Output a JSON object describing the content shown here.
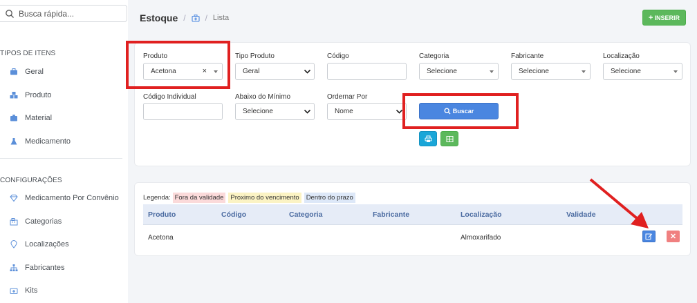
{
  "sidebar": {
    "search_placeholder": "Busca rápida...",
    "section_types": "TIPOS DE ITENS",
    "types": [
      {
        "label": "Geral",
        "icon": "briefcase-icon"
      },
      {
        "label": "Produto",
        "icon": "cubes-icon"
      },
      {
        "label": "Material",
        "icon": "suitcase-icon"
      },
      {
        "label": "Medicamento",
        "icon": "flask-icon"
      }
    ],
    "section_config": "CONFIGURAÇÕES",
    "config": [
      {
        "label": "Medicamento Por Convênio",
        "icon": "diamond-icon"
      },
      {
        "label": "Categorias",
        "icon": "building-icon"
      },
      {
        "label": "Localizações",
        "icon": "map-marker-icon"
      },
      {
        "label": "Fabricantes",
        "icon": "sitemap-icon"
      },
      {
        "label": "Kits",
        "icon": "medkit-icon"
      }
    ]
  },
  "header": {
    "title": "Estoque",
    "breadcrumb_current": "Lista",
    "insert_label": "INSERIR"
  },
  "filters": {
    "produto_label": "Produto",
    "produto_value": "Acetona",
    "tipo_label": "Tipo Produto",
    "tipo_value": "Geral",
    "codigo_label": "Código",
    "codigo_value": "",
    "categoria_label": "Categoria",
    "categoria_value": "Selecione",
    "fabricante_label": "Fabricante",
    "fabricante_value": "Selecione",
    "localizacao_label": "Localização",
    "localizacao_value": "Selecione",
    "codigo_ind_label": "Código Individual",
    "codigo_ind_value": "",
    "abaixo_label": "Abaixo do Mínimo",
    "abaixo_value": "Selecione",
    "ordenar_label": "Ordernar Por",
    "ordenar_value": "Nome",
    "buscar_label": "Buscar"
  },
  "legend": {
    "label": "Legenda:",
    "expired": "Fora da validade",
    "near": "Proximo do vencimento",
    "ok": "Dentro do prazo"
  },
  "table": {
    "columns": [
      "Produto",
      "Código",
      "Categoria",
      "Fabricante",
      "Localização",
      "Validade"
    ],
    "rows": [
      {
        "produto": "Acetona",
        "codigo": "",
        "categoria": "",
        "fabricante": "",
        "localizacao": "Almoxarifado",
        "validade": ""
      }
    ]
  },
  "colors": {
    "primary": "#4a86e0",
    "success": "#5cb85c",
    "info": "#1aa6d8",
    "danger": "#f08080",
    "annotation": "#e02020",
    "legend_expired": "#fbdada",
    "legend_near": "#fbf3c4",
    "legend_ok": "#dde8f8"
  }
}
